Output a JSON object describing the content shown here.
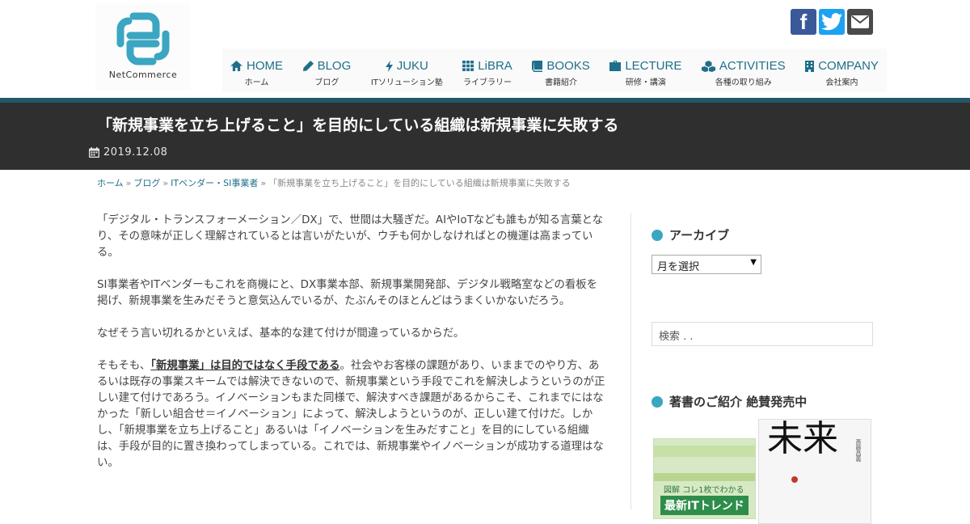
{
  "logo": {
    "text": "NetCommerce"
  },
  "social": [
    {
      "icon": "facebook-icon",
      "glyph": "f"
    },
    {
      "icon": "twitter-icon"
    },
    {
      "icon": "mail-icon"
    }
  ],
  "nav": [
    {
      "label": "HOME",
      "sub": "ホーム",
      "icon": "home-icon"
    },
    {
      "label": "BLOG",
      "sub": "ブログ",
      "icon": "pencil-icon"
    },
    {
      "label": "JUKU",
      "sub": "ITソリューション塾",
      "icon": "bolt-icon"
    },
    {
      "label": "LiBRA",
      "sub": "ライブラリー",
      "icon": "grid-icon"
    },
    {
      "label": "BOOKS",
      "sub": "書籍紹介",
      "icon": "book-icon"
    },
    {
      "label": "LECTURE",
      "sub": "研修・講演",
      "icon": "briefcase-icon"
    },
    {
      "label": "ACTIVITIES",
      "sub": "各種の取り組み",
      "icon": "cubes-icon"
    },
    {
      "label": "COMPANY",
      "sub": "会社案内",
      "icon": "building-icon"
    }
  ],
  "post": {
    "title": "「新規事業を立ち上げること」を目的にしている組織は新規事業に失敗する",
    "date": "2019.12.08"
  },
  "breadcrumb": {
    "home": "ホーム",
    "blog": "ブログ",
    "category": "ITベンダー・SI事業者",
    "current": "「新規事業を立ち上げること」を目的にしている組織は新規事業に失敗する",
    "separator": "»"
  },
  "article": {
    "p1": "「デジタル・トランスフォーメーション／DX」で、世間は大騒ぎだ。AIやIoTなども誰もが知る言葉となり、その意味が正しく理解されているとは言いがたいが、ウチも何かしなければとの機運は高まっている。",
    "p2": "SI事業者やITベンダーもこれを商機にと、DX事業本部、新規事業開発部、デジタル戦略室などの看板を掲げ、新規事業を生みだそうと意気込んでいるが、たぶんそのほとんどはうまくいかないだろう。",
    "p3": "なぜそう言い切れるかといえば、基本的な建て付けが間違っているからだ。",
    "p4_lead": "そもそも、",
    "p4_em": "「新規事業」は目的ではなく手段である",
    "p4_rest": "。社会やお客様の課題があり、いままでのやり方、あるいは既存の事業スキームでは解決できないので、新規事業という手段でこれを解決しようというのが正しい建て付けであろう。イノベーションもまた同様で、解決すべき課題があるからこそ、これまでにはなかった「新しい組合せ＝イノベーション」によって、解決しようというのが、正しい建て付けだ。しかし、「新規事業を立ち上げること」あるいは「イノベーションを生みだすこと」を目的にしている組織は、手段が目的に置き換わってしまっている。これでは、新規事業やイノベーションが成功する道理はない。"
  },
  "sidebar": {
    "archive_title": "アーカイブ",
    "archive_select": "月を選択",
    "search_placeholder": "検索 . .",
    "books_title": "著書のご紹介 絶賛発売中",
    "book1": {
      "tag": "図解",
      "line": "コレ1枚でわかる",
      "title": "最新ITトレンド"
    },
    "book2": {
      "title": "未来",
      "author": "斎藤昌義"
    }
  },
  "colors": {
    "accent": "#3aa6c1",
    "nav": "#1f6f8b",
    "band": "#2f2f2f",
    "teal": "#22586b"
  }
}
